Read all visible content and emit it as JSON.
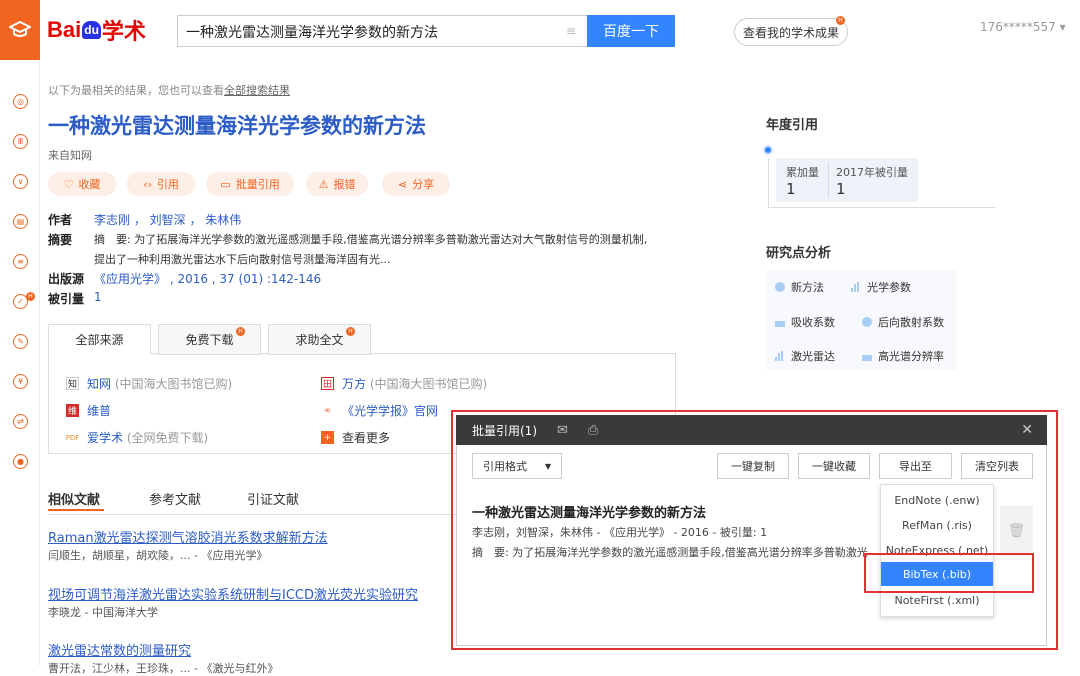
{
  "brand": {
    "text": "Bai",
    "paw": "du",
    "suffix": "学术"
  },
  "search": {
    "value": "一种激光雷达测量海洋光学参数的新方法",
    "button": "百度一下"
  },
  "my_results": "查看我的学术成果",
  "user": "176*****557 ▾",
  "hint": {
    "pre": "以下为最相关的结果，您也可以查看",
    "link": "全部搜索结果"
  },
  "paper": {
    "title": "一种激光雷达测量海洋光学参数的新方法",
    "source": "来自知网",
    "actions": [
      "收藏",
      "引用",
      "批量引用",
      "报错",
      "分享"
    ],
    "author_label": "作者",
    "authors": "李志刚 ， 刘智深 ， 朱林伟",
    "abstract_label": "摘要",
    "abstract1": "摘　要: 为了拓展海洋光学参数的激光遥感测量手段,借鉴高光谱分辨率多普勒激光雷达对大气散射信号的测量机制,",
    "abstract2": "提出了一种利用激光雷达水下后向散射信号测量海洋固有光...",
    "pub_label": "出版源",
    "pub": "《应用光学》 , 2016 , 37 (01) :142-146",
    "cited_label": "被引量",
    "cited": "1"
  },
  "source_tabs": [
    "全部来源",
    "免费下载",
    "求助全文"
  ],
  "sources": [
    {
      "name": "知网",
      "note": " (中国海大图书馆已购)"
    },
    {
      "name": "维普",
      "note": ""
    },
    {
      "name": "爱学术",
      "note": " (全网免费下载)"
    },
    {
      "name": "万方",
      "note": " (中国海大图书馆已购)"
    },
    {
      "name": "《光学学报》官网",
      "note": ""
    },
    {
      "name": "查看更多",
      "note": ""
    }
  ],
  "related_tabs": [
    "相似文献",
    "参考文献",
    "引证文献"
  ],
  "related": [
    {
      "title": "Raman激光雷达探测气溶胶消光系数求解新方法",
      "sub": "闫顺生，胡顺星，胡欢陵，... - 《应用光学》"
    },
    {
      "title": "视场可调节海洋激光雷达实验系统研制与ICCD激光荧光实验研究",
      "sub": "李晓龙 - 中国海洋大学"
    },
    {
      "title": "激光雷达常数的测量研究",
      "sub": "曹开法，江少林，王珍珠，... - 《激光与红外》"
    }
  ],
  "annual": {
    "heading": "年度引用",
    "total_label": "累加量",
    "total": "1",
    "year_label": "2017年被引量",
    "year": "1"
  },
  "analysis": {
    "heading": "研究点分析",
    "keywords": [
      "新方法",
      "光学参数",
      "吸收系数",
      "后向散射系数",
      "激光雷达",
      "高光谱分辨率"
    ]
  },
  "batch": {
    "title": "批量引用(1)",
    "format": "引用格式",
    "copy": "一键复制",
    "collect": "一键收藏",
    "export": "导出至",
    "clear": "清空列表",
    "item_title": "一种激光雷达测量海洋光学参数的新方法",
    "item_meta": "李志刚，刘智深，朱林伟 - 《应用光学》 - 2016 - 被引量: 1",
    "item_abs": "摘　要: 为了拓展海洋光学参数的激光遥感测量手段,借鉴高光谱分辨率多普勒激光",
    "export_options": [
      "EndNote (.enw)",
      "RefMan (.ris)",
      "NoteExpress (.net)",
      "BibTex (.bib)",
      "NoteFirst (.xml)"
    ]
  },
  "colors": {
    "accent": "#f0641f",
    "link": "#2c5cc5",
    "button": "#3385ff",
    "highlight": "#d33333",
    "selected": "#3385ff"
  }
}
